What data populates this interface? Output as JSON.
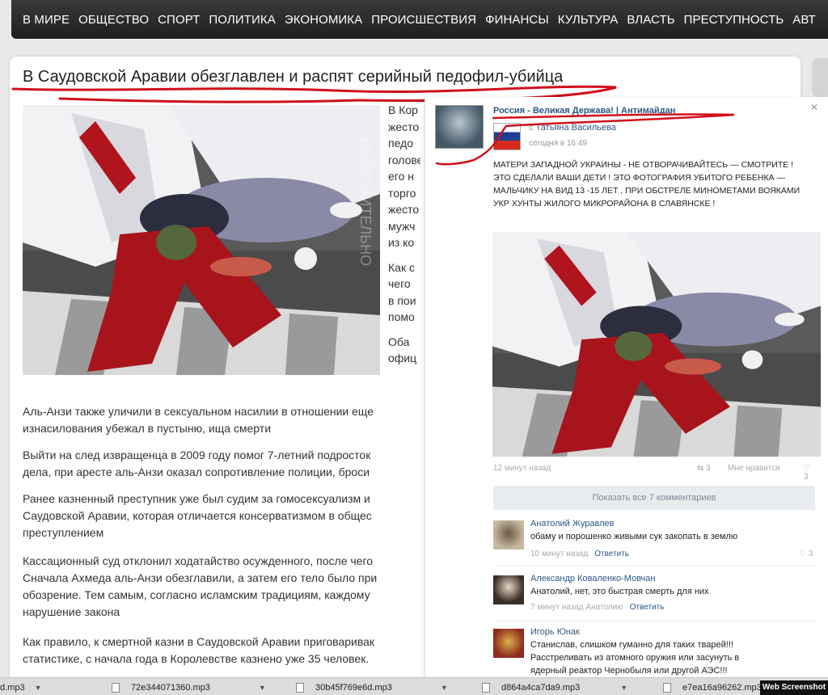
{
  "nav": {
    "items": [
      "В МИРЕ",
      "ОБЩЕСТВО",
      "СПОРТ",
      "ПОЛИТИКА",
      "ЭКОНОМИКА",
      "ПРОИСШЕСТВИЯ",
      "ФИНАНСЫ",
      "КУЛЬТУРА",
      "ВЛАСТЬ",
      "ПРЕСТУПНОСТЬ",
      "АВТ"
    ]
  },
  "article": {
    "title": "В Саудовской Аравии обезглавлен и распят серийный педофил-убийца",
    "photo_watermark": "ДЕЙСТВИТЕЛЬНО",
    "side_text": [
      "В Кор",
      "жесто",
      "педо",
      "голове",
      "его н",
      "торго",
      "жесто",
      "мужч",
      "из ко",
      "",
      "Как с",
      "чего",
      "в пои",
      "помо",
      "",
      "Оба",
      "офиц"
    ],
    "paragraphs": [
      [
        "Аль-Анзи также уличили в сексуальном насилии в отношении еще",
        "изнасилования убежал в пустыню, ища смерти"
      ],
      [
        "Выйти на след извращенца в 2009 году помог 7-летний подросток",
        "дела, при аресте аль-Анзи оказал сопротивление полиции, броси"
      ],
      [
        "Ранее казненный преступник уже был судим за гомосексуализм и",
        "Саудовской Аравии, которая отличается консерватизмом в общес",
        "преступлением"
      ],
      [
        "Кассационный суд отклонил ходатайство осужденного, после чего",
        "Сначала Ахмеда аль-Анзи обезглавили, а затем его тело было при",
        "обозрение. Тем самым, согласно исламским традициям, каждому",
        "нарушение закона"
      ],
      [
        "Как правило, к смертной казни в Саудовской Аравии приговаривак",
        "статистике, с начала года в Королевстве казнено уже 35 человек."
      ]
    ]
  },
  "post": {
    "group": "Россия - Великая Держава! | Антимайдан",
    "author_prefix": "с",
    "author": "Татьяна Васильева",
    "time": "сегодня в 16:49",
    "text": "МАТЕРИ ЗАПАДНОЙ УКРАИНЫ - НЕ ОТВОРАЧИВАЙТЕСЬ — СМОТРИТЕ ! ЭТО СДЕЛАЛИ ВАШИ ДЕТИ ! ЭТО ФОТОГРАФИЯ УБИТОГО РЕБЕНКА —МАЛЬЧИКУ НА ВИД 13 -15 ЛЕТ , ПРИ ОБСТРЕЛЕ МИНОМЕТАМИ ВОЯКАМИ УКР ХУНТЫ ЖИЛОГО МИКРОРАЙОНА В СЛАВЯНСКЕ !",
    "meta_time": "12 минут назад",
    "share_count": "3",
    "like_label": "Мне нравится",
    "like_count": "3",
    "show_all": "Показать все 7 комментариев",
    "comments": [
      {
        "name": "Анатолий Журавлев",
        "text": "обаму и порошенко живыми сук закопать в землю",
        "text2": "",
        "meta": "10 минут назад",
        "reply": "Ответить",
        "likes": "3"
      },
      {
        "name": "Александр Коваленко-Мовчан",
        "text": "Анатолий, нет, это быстрая смерть для них",
        "text2": "",
        "meta": "7 минут назад Анатолию",
        "reply": "Ответить",
        "likes": ""
      },
      {
        "name": "Игорь Юнак",
        "text": "Станислав, слишком гуманно для таких тварей!!!",
        "text2": "Расстреливать из атомного оружия или засунуть в",
        "meta": "",
        "reply": "",
        "likes": ""
      }
    ],
    "comment3_line3": "ядерный реактор Чернобыля или другой АЭС!!!"
  },
  "downloads": [
    {
      "name": "d.mp3"
    },
    {
      "name": "72e344071360.mp3"
    },
    {
      "name": "30b45f769e6d.mp3"
    },
    {
      "name": "d864a4ca7da9.mp3"
    },
    {
      "name": "e7ea16a96262.mp3"
    }
  ],
  "badge": "Web Screenshot"
}
